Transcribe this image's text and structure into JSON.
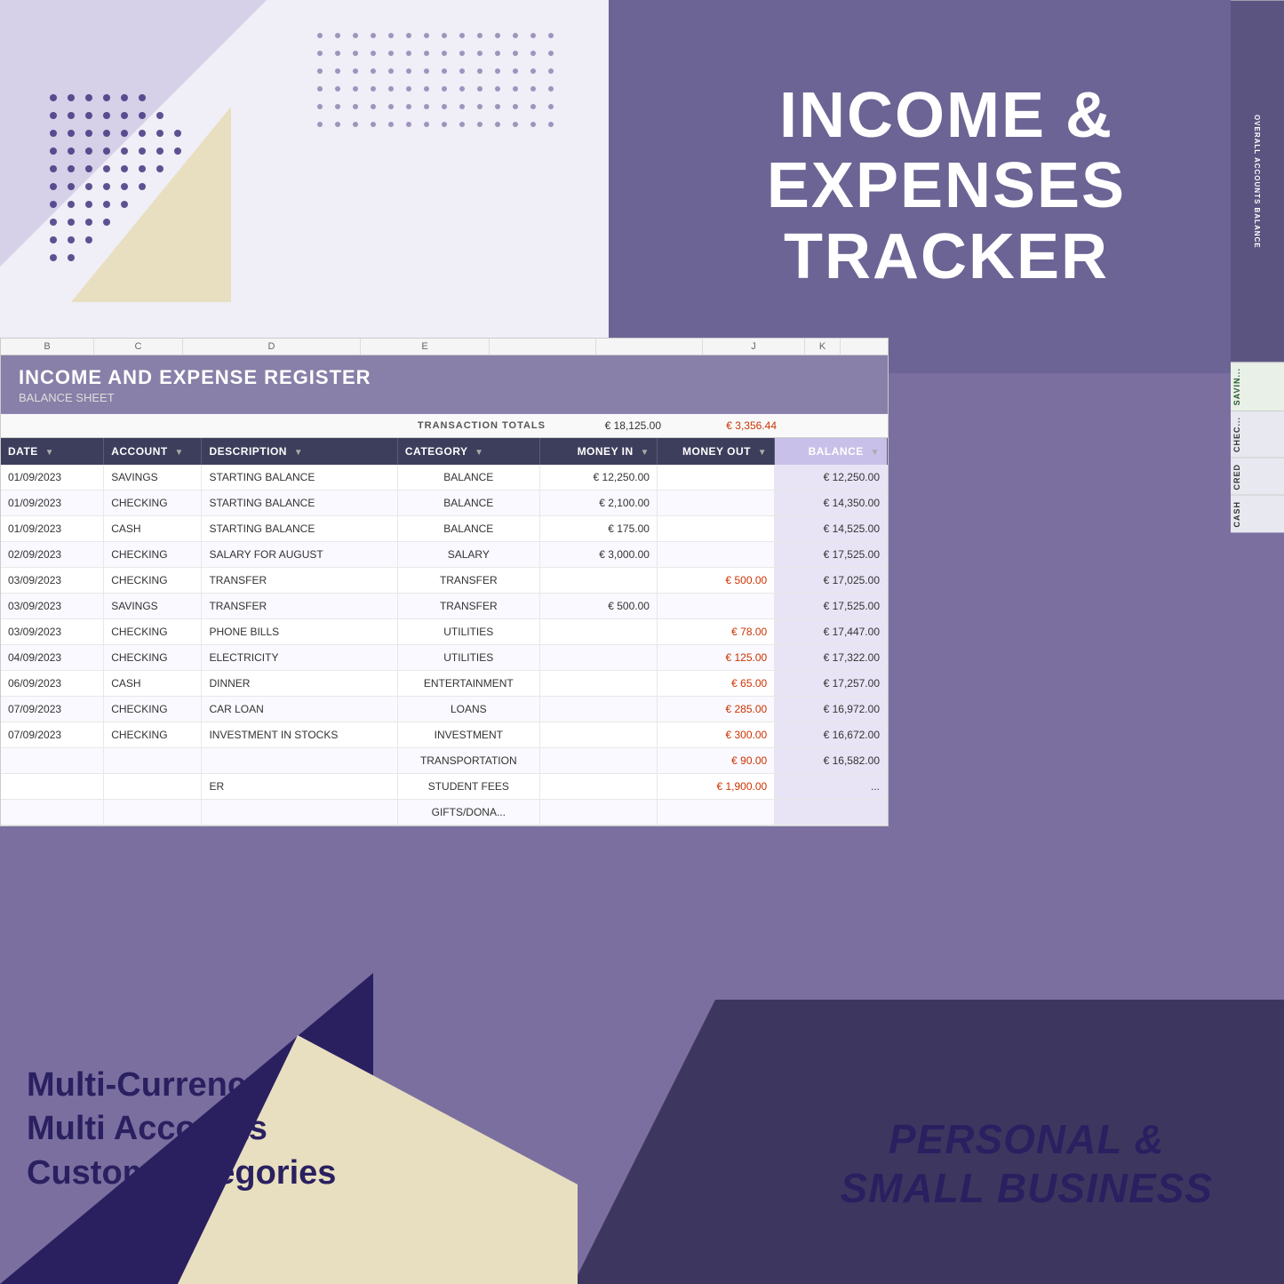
{
  "header": {
    "title_line1": "INCOME &",
    "title_line2": "EXPENSES",
    "title_line3": "TRACKER"
  },
  "sheet": {
    "title": "INCOME AND EXPENSE REGISTER",
    "subtitle": "BALANCE SHEET"
  },
  "totals": {
    "label": "TRANSACTION TOTALS",
    "money_in": "€ 18,125.00",
    "money_out": "€ 3,356.44"
  },
  "table": {
    "columns": [
      "DATE",
      "ACCOUNT",
      "DESCRIPTION",
      "CATEGORY",
      "MONEY IN",
      "MONEY OUT",
      "BALANCE"
    ],
    "rows": [
      {
        "date": "01/09/2023",
        "account": "SAVINGS",
        "description": "STARTING BALANCE",
        "category": "BALANCE",
        "money_in": "€ 12,250.00",
        "money_out": "",
        "balance": "€ 12,250.00"
      },
      {
        "date": "01/09/2023",
        "account": "CHECKING",
        "description": "STARTING BALANCE",
        "category": "BALANCE",
        "money_in": "€ 2,100.00",
        "money_out": "",
        "balance": "€ 14,350.00"
      },
      {
        "date": "01/09/2023",
        "account": "CASH",
        "description": "STARTING BALANCE",
        "category": "BALANCE",
        "money_in": "€ 175.00",
        "money_out": "",
        "balance": "€ 14,525.00"
      },
      {
        "date": "02/09/2023",
        "account": "CHECKING",
        "description": "SALARY FOR AUGUST",
        "category": "SALARY",
        "money_in": "€ 3,000.00",
        "money_out": "",
        "balance": "€ 17,525.00"
      },
      {
        "date": "03/09/2023",
        "account": "CHECKING",
        "description": "TRANSFER",
        "category": "TRANSFER",
        "money_in": "",
        "money_out": "€ 500.00",
        "balance": "€ 17,025.00"
      },
      {
        "date": "03/09/2023",
        "account": "SAVINGS",
        "description": "TRANSFER",
        "category": "TRANSFER",
        "money_in": "€ 500.00",
        "money_out": "",
        "balance": "€ 17,525.00"
      },
      {
        "date": "03/09/2023",
        "account": "CHECKING",
        "description": "PHONE BILLS",
        "category": "UTILITIES",
        "money_in": "",
        "money_out": "€ 78.00",
        "balance": "€ 17,447.00"
      },
      {
        "date": "04/09/2023",
        "account": "CHECKING",
        "description": "ELECTRICITY",
        "category": "UTILITIES",
        "money_in": "",
        "money_out": "€ 125.00",
        "balance": "€ 17,322.00"
      },
      {
        "date": "06/09/2023",
        "account": "CASH",
        "description": "DINNER",
        "category": "ENTERTAINMENT",
        "money_in": "",
        "money_out": "€ 65.00",
        "balance": "€ 17,257.00"
      },
      {
        "date": "07/09/2023",
        "account": "CHECKING",
        "description": "CAR LOAN",
        "category": "LOANS",
        "money_in": "",
        "money_out": "€ 285.00",
        "balance": "€ 16,972.00"
      },
      {
        "date": "07/09/2023",
        "account": "CHECKING",
        "description": "INVESTMENT IN STOCKS",
        "category": "INVESTMENT",
        "money_in": "",
        "money_out": "€ 300.00",
        "balance": "€ 16,672.00"
      },
      {
        "date": "",
        "account": "",
        "description": "",
        "category": "TRANSPORTATION",
        "money_in": "",
        "money_out": "€ 90.00",
        "balance": "€ 16,582.00"
      },
      {
        "date": "",
        "account": "",
        "description": "ER",
        "category": "STUDENT FEES",
        "money_in": "",
        "money_out": "€ 1,900.00",
        "balance": "..."
      },
      {
        "date": "",
        "account": "",
        "description": "",
        "category": "GIFTS/DONA...",
        "money_in": "",
        "money_out": "",
        "balance": ""
      }
    ]
  },
  "sidebar": {
    "items": [
      "OVERALL ACCOUNTS BALANCE",
      "SAVIN...",
      "CHEC...",
      "CRED",
      "CASH"
    ]
  },
  "features": {
    "line1": "Multi-Currency",
    "line2": "Multi Accounts",
    "line3": "Custom Categories"
  },
  "tagline": {
    "line1": "PERSONAL &",
    "line2": "SMALL BUSINESS"
  }
}
